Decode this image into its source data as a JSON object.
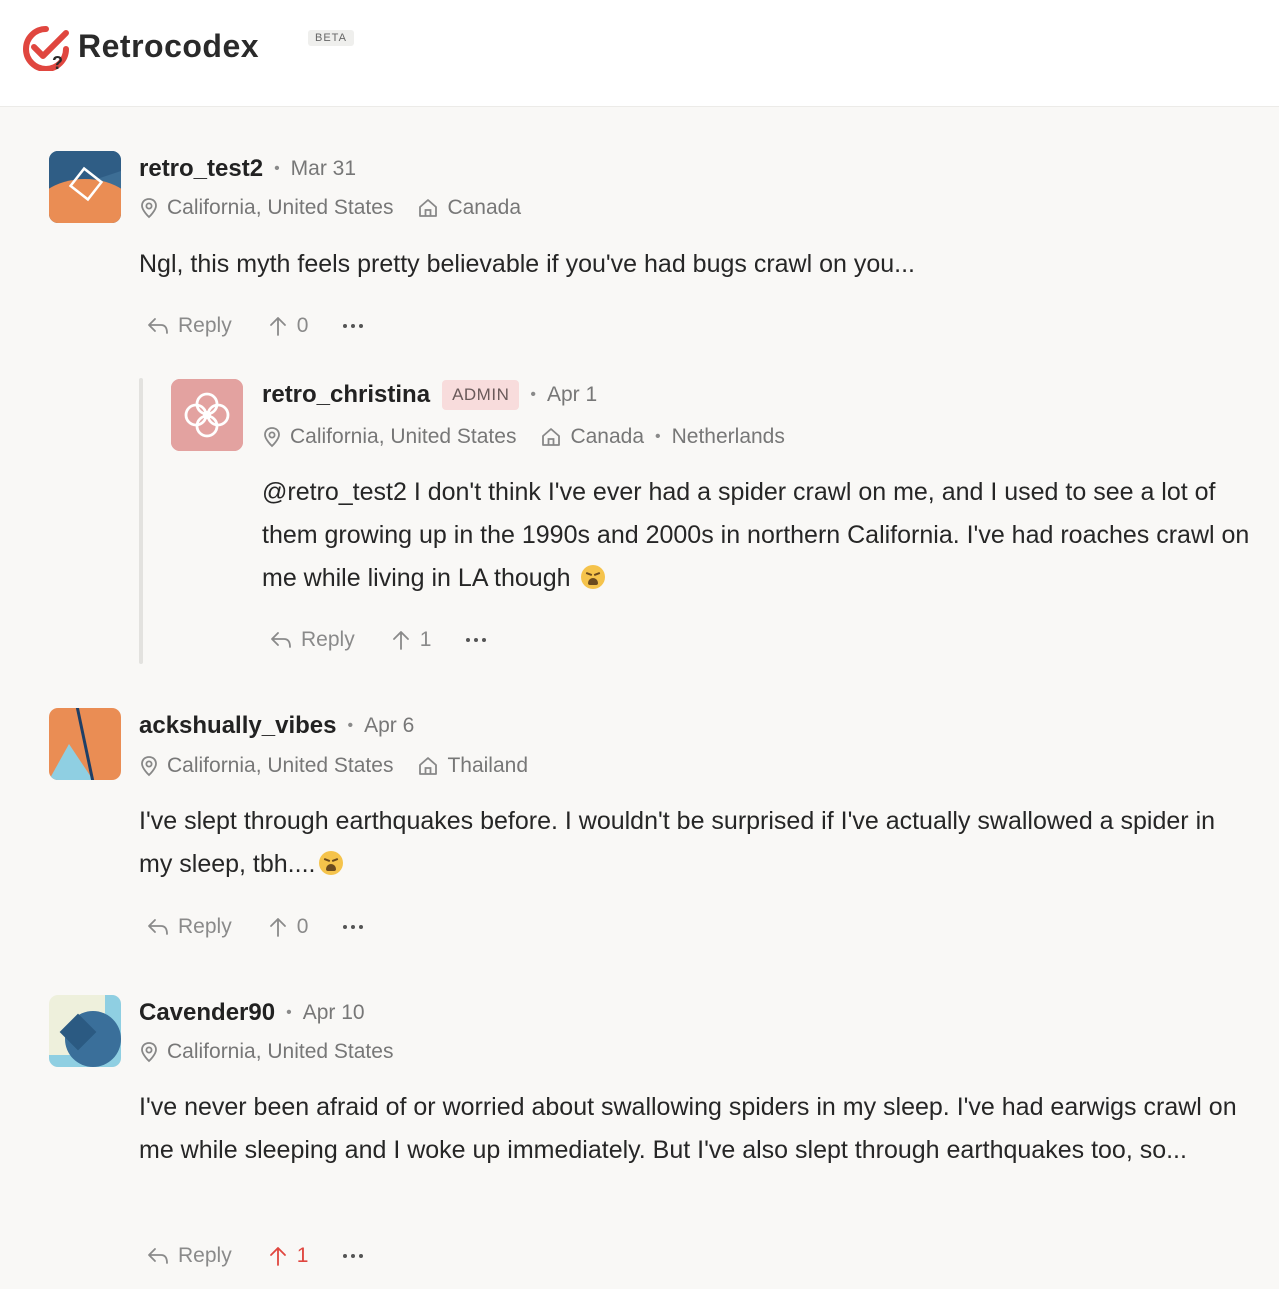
{
  "app": {
    "name": "Retrocodex",
    "badge": "BETA"
  },
  "comments": [
    {
      "username": "retro_test2",
      "date": "Mar 31",
      "location": "California, United States",
      "home": "Canada",
      "text": "Ngl, this myth feels pretty believable if you've had bugs crawl on you...",
      "reply_label": "Reply",
      "votes": "0"
    },
    {
      "username": "retro_christina",
      "role": "ADMIN",
      "date": "Apr 1",
      "location": "California, United States",
      "home": "Canada",
      "home2": "Netherlands",
      "text": "@retro_test2 I don't think I've ever had a spider crawl on me, and I used to see a lot of them growing up in the 1990s and 2000s in northern California. I've had roaches crawl on me while living in LA though",
      "reply_label": "Reply",
      "votes": "1"
    },
    {
      "username": "ackshually_vibes",
      "date": "Apr 6",
      "location": "California, United States",
      "home": "Thailand",
      "text": "I've slept through earthquakes before. I wouldn't be surprised if I've actually swallowed a spider in my sleep, tbh....",
      "reply_label": "Reply",
      "votes": "0"
    },
    {
      "username": "Cavender90",
      "date": "Apr 10",
      "location": "California, United States",
      "text": "I've never been afraid of or worried about swallowing spiders in my sleep. I've had earwigs crawl on me while sleeping and I woke up immediately. But I've also slept through earthquakes too, so...",
      "reply_label": "Reply",
      "votes": "1",
      "voted": true
    }
  ],
  "colors": {
    "accent": "#e0463f",
    "admin_badge_bg": "#f8dcdc",
    "background": "#f9f8f6"
  },
  "icons": [
    "reply-icon",
    "upvote-icon",
    "more-icon",
    "location-pin-icon",
    "home-icon"
  ]
}
